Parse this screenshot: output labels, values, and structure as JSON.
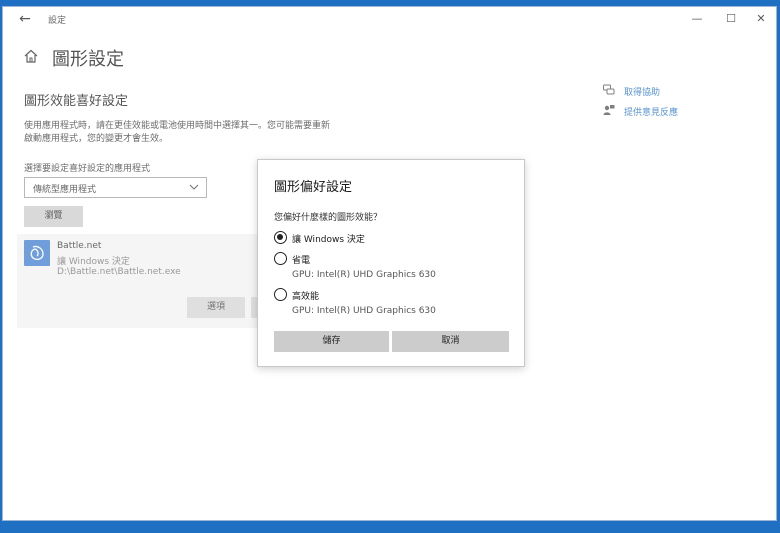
{
  "window": {
    "app_title": "設定",
    "back_glyph": "←",
    "minimize_glyph": "—",
    "maximize_glyph": "☐",
    "close_glyph": "✕"
  },
  "page": {
    "title": "圖形設定",
    "section_title": "圖形效能喜好設定",
    "description": "使用應用程式時，請在更佳效能或電池使用時間中選擇其一。您可能需要重新啟動應用程式，您的變更才會生效。",
    "select_label": "選擇要設定喜好設定的應用程式",
    "dropdown_value": "傳統型應用程式",
    "browse_label": "瀏覽"
  },
  "app_item": {
    "name": "Battle.net",
    "setting": "讓 Windows 決定",
    "path": "D:\\Battle.net\\Battle.net.exe",
    "options_label": "選項"
  },
  "side_links": {
    "help": "取得協助",
    "feedback": "提供意見反應"
  },
  "dialog": {
    "title": "圖形偏好設定",
    "question": "您偏好什麼樣的圖形效能？",
    "options": [
      {
        "label": "讓 Windows 決定",
        "checked": true
      },
      {
        "label": "省電",
        "gpu": "GPU: Intel(R) UHD Graphics 630",
        "checked": false
      },
      {
        "label": "高效能",
        "gpu": "GPU: Intel(R) UHD Graphics 630",
        "checked": false
      }
    ],
    "save_label": "儲存",
    "cancel_label": "取消"
  },
  "colors": {
    "accent": "#1f6fc2",
    "desktop": "#1f6fc2",
    "button_gray": "#cccccc"
  }
}
